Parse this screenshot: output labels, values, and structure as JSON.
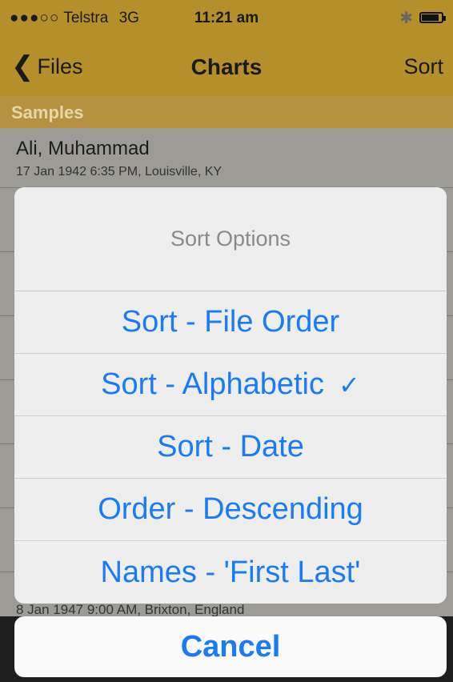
{
  "status_bar": {
    "signal": "●●●○○",
    "carrier": "Telstra",
    "network": "3G",
    "time": "11:21 am",
    "bluetooth": "✱"
  },
  "nav": {
    "back_label": "Files",
    "title": "Charts",
    "sort_label": "Sort"
  },
  "section_header": "Samples",
  "rows": [
    {
      "name": "Ali, Muhammad",
      "subtitle": "17 Jan 1942 6:35 PM, Louisville, KY"
    }
  ],
  "last_row_subtitle": "8 Jan 1947 9:00 AM, Brixton, England",
  "sort_sheet": {
    "title": "Sort Options",
    "options": [
      {
        "label": "Sort - File Order",
        "checked": false
      },
      {
        "label": "Sort - Alphabetic",
        "checked": true,
        "check_mark": "✓"
      },
      {
        "label": "Sort - Date",
        "checked": false
      },
      {
        "label": "Order - Descending",
        "checked": false
      },
      {
        "label": "Names - 'First Last'",
        "checked": false
      }
    ],
    "cancel_label": "Cancel"
  },
  "colors": {
    "bar": "#b48f2a",
    "accent": "#1a7cf5",
    "section": "#b69240"
  }
}
